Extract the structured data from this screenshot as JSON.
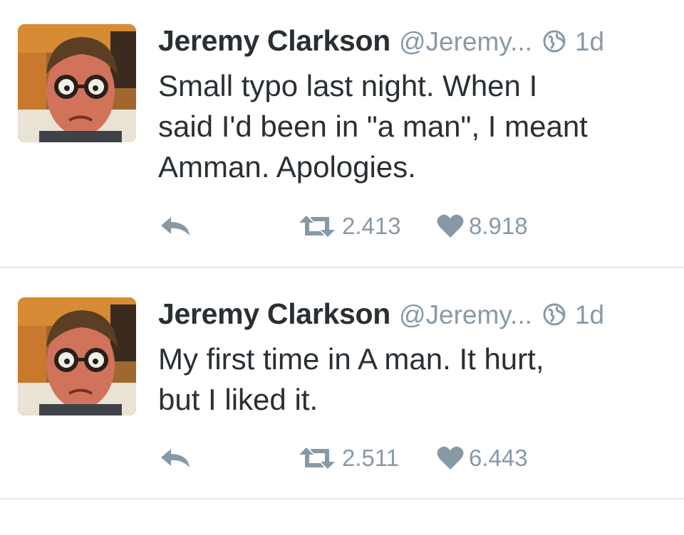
{
  "colors": {
    "text": "#292f33",
    "secondary": "#8899a6",
    "divider": "#e1e8ed"
  },
  "tweets": [
    {
      "name": "Jeremy Clarkson",
      "handle": "@Jeremy...",
      "time": "1d",
      "text": "Small typo last night. When I\nsaid I'd been in \"a man\", I meant\nAmman. Apologies.",
      "retweets": "2.413",
      "likes": "8.918",
      "avatar_icon": "profile-photo",
      "visibility_icon": "globe-icon"
    },
    {
      "name": "Jeremy Clarkson",
      "handle": "@Jeremy...",
      "time": "1d",
      "text": "My first time in A man. It hurt,\nbut I liked it.",
      "retweets": "2.511",
      "likes": "6.443",
      "avatar_icon": "profile-photo",
      "visibility_icon": "globe-icon"
    }
  ]
}
